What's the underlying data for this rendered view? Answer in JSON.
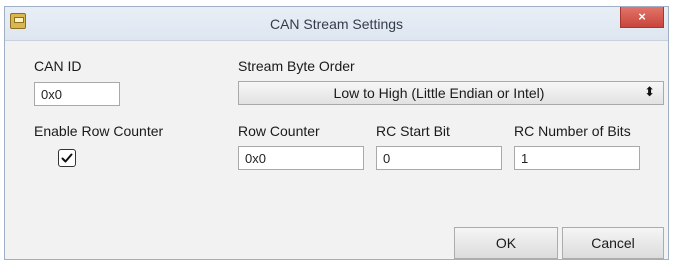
{
  "window": {
    "title": "CAN Stream Settings",
    "close_label": "×"
  },
  "can_id": {
    "label": "CAN ID",
    "value": "0x0"
  },
  "byte_order": {
    "label": "Stream Byte Order",
    "selected": "Low to High (Little Endian or Intel)",
    "arrow": "⬍"
  },
  "row_counter_enable": {
    "label": "Enable Row Counter",
    "checked": true
  },
  "row_counter": {
    "label": "Row Counter",
    "value": "0x0"
  },
  "rc_start_bit": {
    "label": "RC Start Bit",
    "value": "0"
  },
  "rc_number_of_bits": {
    "label": "RC Number of Bits",
    "value": "1"
  },
  "buttons": {
    "ok": "OK",
    "cancel": "Cancel"
  }
}
